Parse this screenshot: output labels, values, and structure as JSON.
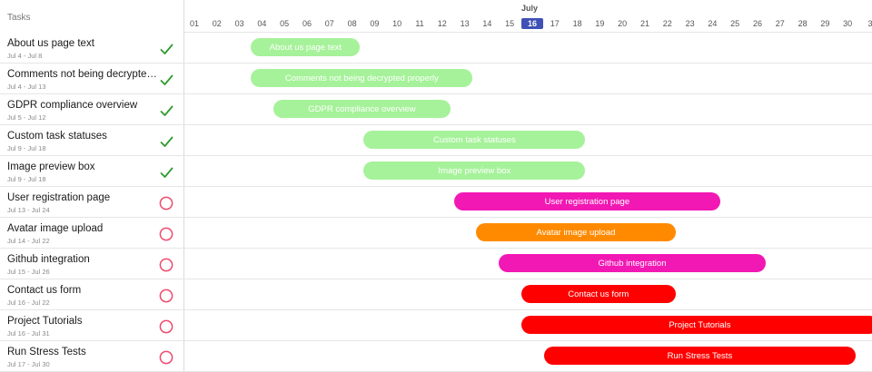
{
  "header": {
    "tasks_title": "Tasks",
    "month": "July"
  },
  "timeline": {
    "days": [
      "01",
      "02",
      "03",
      "04",
      "05",
      "06",
      "07",
      "08",
      "09",
      "10",
      "11",
      "12",
      "13",
      "14",
      "15",
      "16",
      "17",
      "18",
      "19",
      "20",
      "21",
      "22",
      "23",
      "24",
      "25",
      "26",
      "27",
      "28",
      "29",
      "30",
      "3"
    ],
    "today": "16"
  },
  "colors": {
    "done_bar": "#a6f29a",
    "pink": "#f218b4",
    "orange": "#ff8a00",
    "red": "#ff0000",
    "check": "#2e9a2e",
    "circle": "#ef4a6c",
    "today_badge": "#3f51b5"
  },
  "tasks": [
    {
      "name": "About us page text",
      "dates": "Jul 4 - Jul 8",
      "status": "done",
      "start": 4,
      "end": 8,
      "color": "#a6f29a",
      "text_color": "#ffffff",
      "status_icon": "check-icon"
    },
    {
      "name": "Comments not being decrypted properly",
      "dates": "Jul 4 - Jul 13",
      "status": "done",
      "start": 4,
      "end": 13,
      "color": "#a6f29a",
      "text_color": "#ffffff",
      "status_icon": "check-icon"
    },
    {
      "name": "GDPR compliance overview",
      "dates": "Jul 5 - Jul 12",
      "status": "done",
      "start": 5,
      "end": 12,
      "color": "#a6f29a",
      "text_color": "#ffffff",
      "status_icon": "check-icon"
    },
    {
      "name": "Custom task statuses",
      "dates": "Jul 9 - Jul 18",
      "status": "done",
      "start": 9,
      "end": 18,
      "color": "#a6f29a",
      "text_color": "#ffffff",
      "status_icon": "check-icon"
    },
    {
      "name": "Image preview box",
      "dates": "Jul 9 - Jul 18",
      "status": "done",
      "start": 9,
      "end": 18,
      "color": "#a6f29a",
      "text_color": "#ffffff",
      "status_icon": "check-icon"
    },
    {
      "name": "User registration page",
      "dates": "Jul 13 - Jul 24",
      "status": "open",
      "start": 13,
      "end": 24,
      "color": "#f218b4",
      "text_color": "#ffffff",
      "status_icon": "circle-icon"
    },
    {
      "name": "Avatar image upload",
      "dates": "Jul 14 - Jul 22",
      "status": "open",
      "start": 14,
      "end": 22,
      "color": "#ff8a00",
      "text_color": "#ffffff",
      "status_icon": "circle-icon"
    },
    {
      "name": "Github integration",
      "dates": "Jul 15 - Jul 26",
      "status": "open",
      "start": 15,
      "end": 26,
      "color": "#f218b4",
      "text_color": "#ffffff",
      "status_icon": "circle-icon"
    },
    {
      "name": "Contact us form",
      "dates": "Jul 16 - Jul 22",
      "status": "open",
      "start": 16,
      "end": 22,
      "color": "#ff0000",
      "text_color": "#ffffff",
      "status_icon": "circle-icon"
    },
    {
      "name": "Project Tutorials",
      "dates": "Jul 16 - Jul 31",
      "status": "open",
      "start": 16,
      "end": 31,
      "color": "#ff0000",
      "text_color": "#ffffff",
      "status_icon": "circle-icon"
    },
    {
      "name": "Run Stress Tests",
      "dates": "Jul 17 - Jul 30",
      "status": "open",
      "start": 17,
      "end": 30,
      "color": "#ff0000",
      "text_color": "#ffffff",
      "status_icon": "circle-icon"
    }
  ]
}
